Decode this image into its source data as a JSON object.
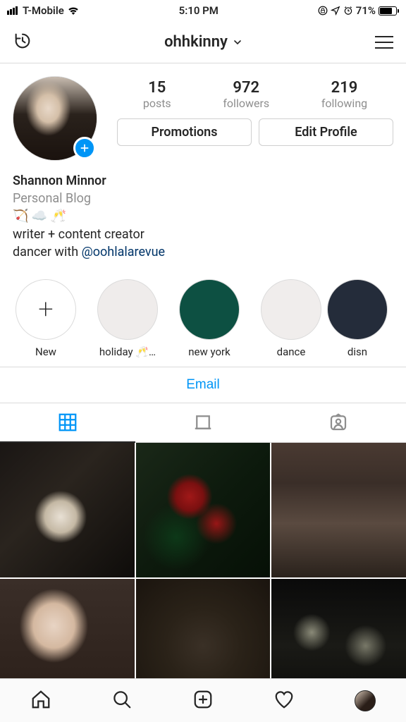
{
  "status_bar": {
    "carrier": "T-Mobile",
    "time": "5:10 PM",
    "battery_percent": "71%",
    "battery_fill": 71
  },
  "header": {
    "username": "ohhkinny"
  },
  "profile": {
    "stats": {
      "posts_count": "15",
      "posts_label": "posts",
      "followers_count": "972",
      "followers_label": "followers",
      "following_count": "219",
      "following_label": "following"
    },
    "buttons": {
      "promotions": "Promotions",
      "edit": "Edit Profile"
    },
    "bio": {
      "name": "Shannon Minnor",
      "category": "Personal Blog",
      "emoji_line": "🏹 ☁️ 🥂",
      "line1": "writer + content creator",
      "line2_prefix": "dancer with ",
      "mention": "@oohlalarevue"
    }
  },
  "highlights": [
    {
      "label": "New",
      "type": "new"
    },
    {
      "label": "holiday 🥂…",
      "type": "holiday"
    },
    {
      "label": "new york",
      "type": "ny"
    },
    {
      "label": "dance",
      "type": "dance"
    },
    {
      "label": "disn",
      "type": "disn"
    }
  ],
  "contact": {
    "email": "Email"
  }
}
